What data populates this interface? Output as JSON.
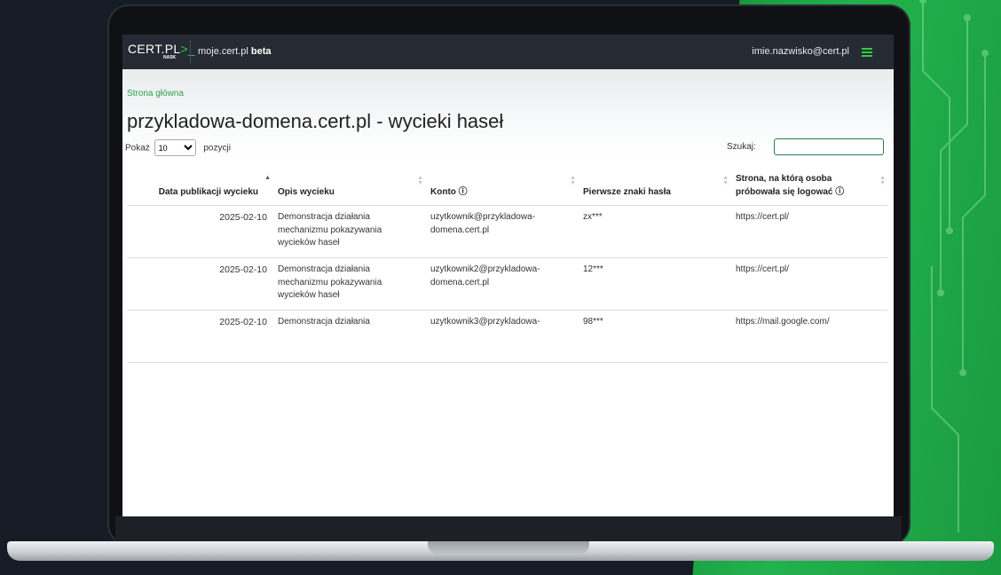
{
  "navbar": {
    "logo_main": "CERT.PL",
    "logo_accent": ">_",
    "logo_sub": "NASK",
    "app_name": "moje.cert.pl",
    "app_badge": "beta",
    "user_email": "imie.nazwisko@cert.pl"
  },
  "breadcrumb": "Strona główna",
  "page_title": "przykladowa-domena.cert.pl - wycieki haseł",
  "length": {
    "label_before": "Pokaż",
    "selected": "10",
    "label_after": "pozycji"
  },
  "search": {
    "label": "Szukaj:",
    "value": ""
  },
  "table": {
    "headers": [
      "Data publikacji wycieku",
      "Opis wycieku",
      "Konto ⓘ",
      "Pierwsze znaki hasła",
      "Strona, na którą osoba próbowała się logować ⓘ"
    ],
    "rows": [
      {
        "date": "2025-02-10",
        "description": "Demonstracja działania mechanizmu pokazywania wycieków haseł",
        "account": "uzytkownik@przykladowa-domena.cert.pl",
        "password": "zx***",
        "site": "https://cert.pl/"
      },
      {
        "date": "2025-02-10",
        "description": "Demonstracja działania mechanizmu pokazywania wycieków haseł",
        "account": "uzytkownik2@przykladowa-domena.cert.pl",
        "password": "12***",
        "site": "https://cert.pl/"
      },
      {
        "date": "2025-02-10",
        "description": "Demonstracja działania",
        "account": "uzytkownik3@przykladowa-",
        "password": "98***",
        "site": "https://mail.google.com/"
      }
    ]
  },
  "colors": {
    "accent_green": "#2ecc40",
    "link_green": "#2ca24a",
    "navbar_bg": "#262b33"
  },
  "icons": [
    "hamburger-menu-icon",
    "sort-arrow-icon",
    "info-circle-icon"
  ]
}
